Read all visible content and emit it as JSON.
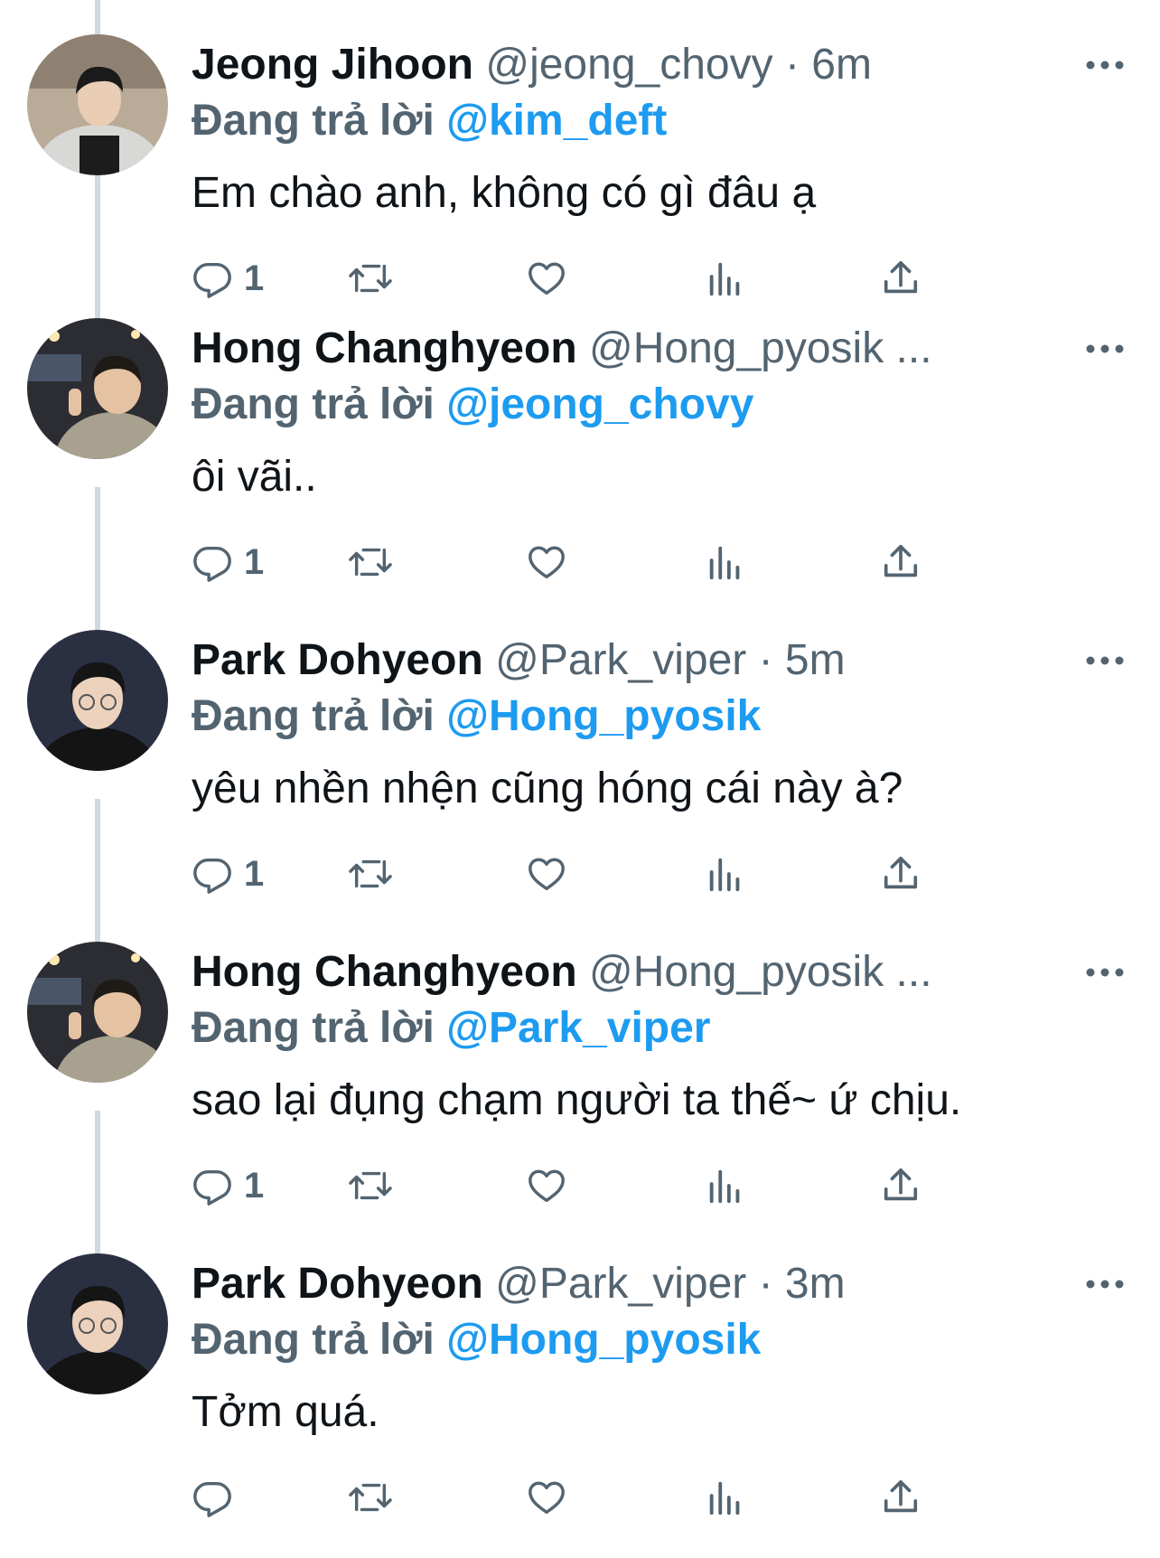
{
  "tweets": [
    {
      "name": "Jeong Jihoon",
      "meta": "@jeong_chovy · 6m",
      "reply_label": "Đang trả lời",
      "reply_to": "@kim_deft",
      "text": "Em chào anh, không có gì đâu ạ",
      "reply_count": "1",
      "avatar": "avatar-jihoon"
    },
    {
      "name": "Hong Changhyeon",
      "meta": "@Hong_pyosik ...",
      "reply_label": "Đang trả lời",
      "reply_to": "@jeong_chovy",
      "text": "ôi vãi..",
      "reply_count": "1",
      "avatar": "avatar-changhyeon"
    },
    {
      "name": "Park Dohyeon",
      "meta": "@Park_viper · 5m",
      "reply_label": "Đang trả lời",
      "reply_to": "@Hong_pyosik",
      "text": "yêu nhền nhện cũng hóng cái này à?",
      "reply_count": "1",
      "avatar": "avatar-dohyeon"
    },
    {
      "name": "Hong Changhyeon",
      "meta": "@Hong_pyosik ...",
      "reply_label": "Đang trả lời",
      "reply_to": "@Park_viper",
      "text": "sao lại đụng chạm người ta thế~ ứ chịu.",
      "reply_count": "1",
      "avatar": "avatar-changhyeon"
    },
    {
      "name": "Park Dohyeon",
      "meta": "@Park_viper · 3m",
      "reply_label": "Đang trả lời",
      "reply_to": "@Hong_pyosik",
      "text": "Tởm quá.",
      "reply_count": "",
      "avatar": "avatar-dohyeon"
    }
  ],
  "icons": {
    "reply": "reply-icon",
    "retweet": "retweet-icon",
    "like": "like-icon",
    "views": "views-icon",
    "share": "share-icon",
    "more": "more-icon"
  },
  "colors": {
    "text": "#0f1419",
    "secondary": "#536471",
    "link": "#1d9bf0",
    "thread_line": "#cfd9de"
  }
}
